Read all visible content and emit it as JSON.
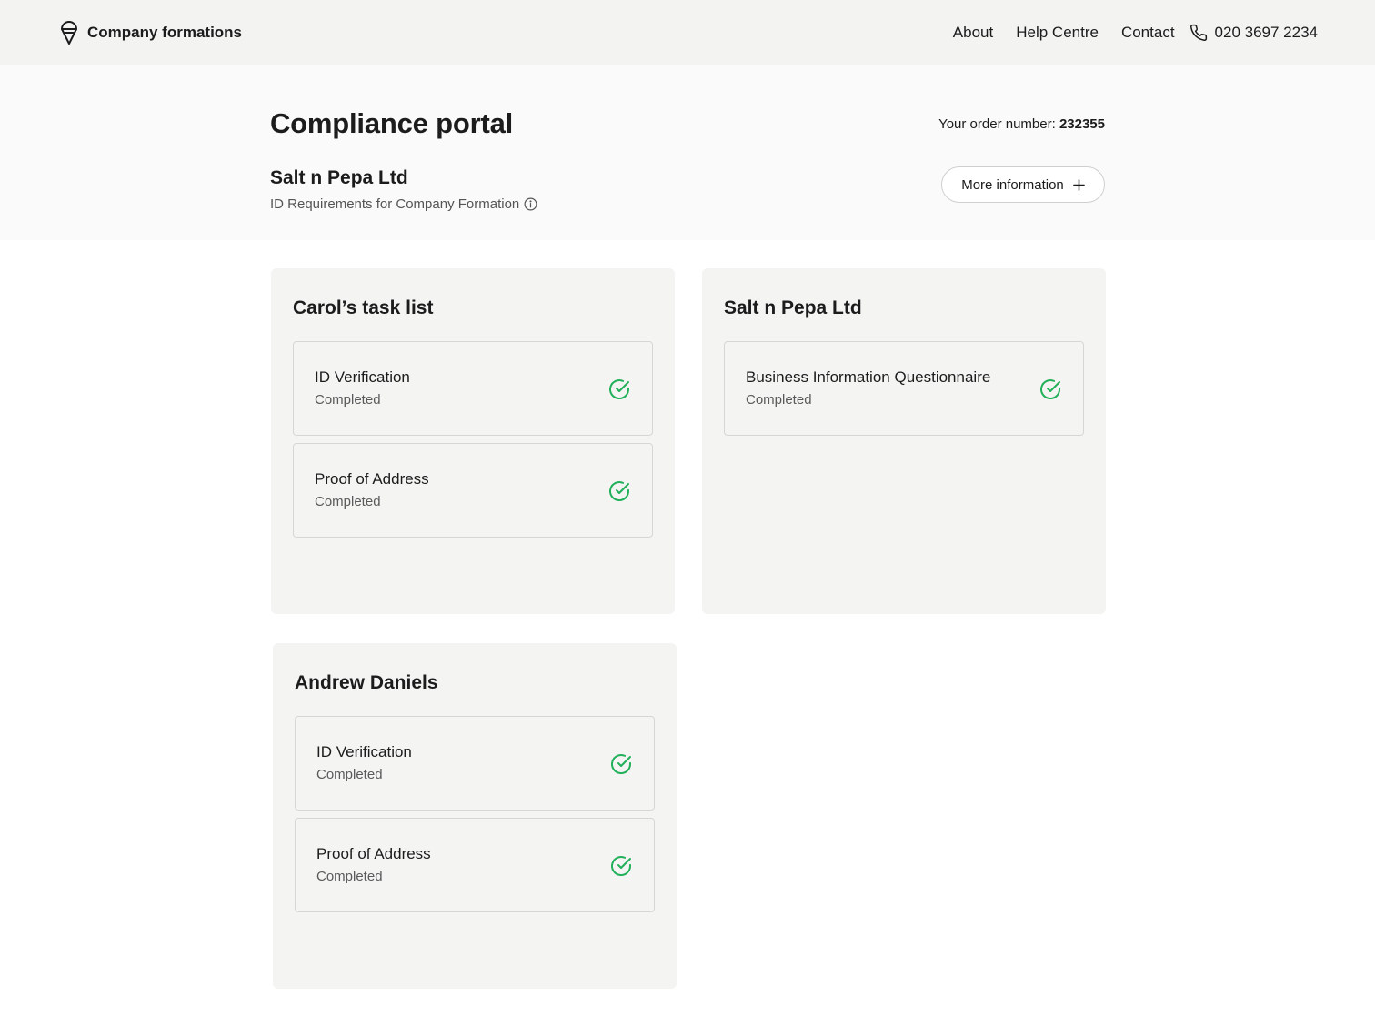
{
  "header": {
    "brand_name": "Company formations",
    "nav": {
      "about": "About",
      "help": "Help Centre",
      "contact": "Contact",
      "phone": "020 3697 2234"
    }
  },
  "hero": {
    "title": "Compliance portal",
    "order_label": "Your order number:",
    "order_number": "232355",
    "company_name": "Salt n Pepa Ltd",
    "subtitle": "ID Requirements for Company Formation",
    "more_button": "More information"
  },
  "panels": [
    {
      "title": "Carol’s task list",
      "tasks": [
        {
          "name": "ID Verification",
          "status": "Completed"
        },
        {
          "name": "Proof of Address",
          "status": "Completed"
        }
      ]
    },
    {
      "title": "Salt n Pepa Ltd",
      "tasks": [
        {
          "name": "Business Information Questionnaire",
          "status": "Completed"
        }
      ]
    },
    {
      "title": "Andrew Daniels",
      "tasks": [
        {
          "name": "ID Verification",
          "status": "Completed"
        },
        {
          "name": "Proof of Address",
          "status": "Completed"
        }
      ]
    }
  ],
  "colors": {
    "success": "#22b05a",
    "header_bg": "#f3f3f2",
    "panel_bg": "#f4f4f3"
  },
  "icons": {
    "brand": "ice-cream-cone-icon",
    "phone": "phone-icon",
    "info": "info-icon",
    "plus": "plus-icon",
    "task_status": "check-circle-icon"
  }
}
